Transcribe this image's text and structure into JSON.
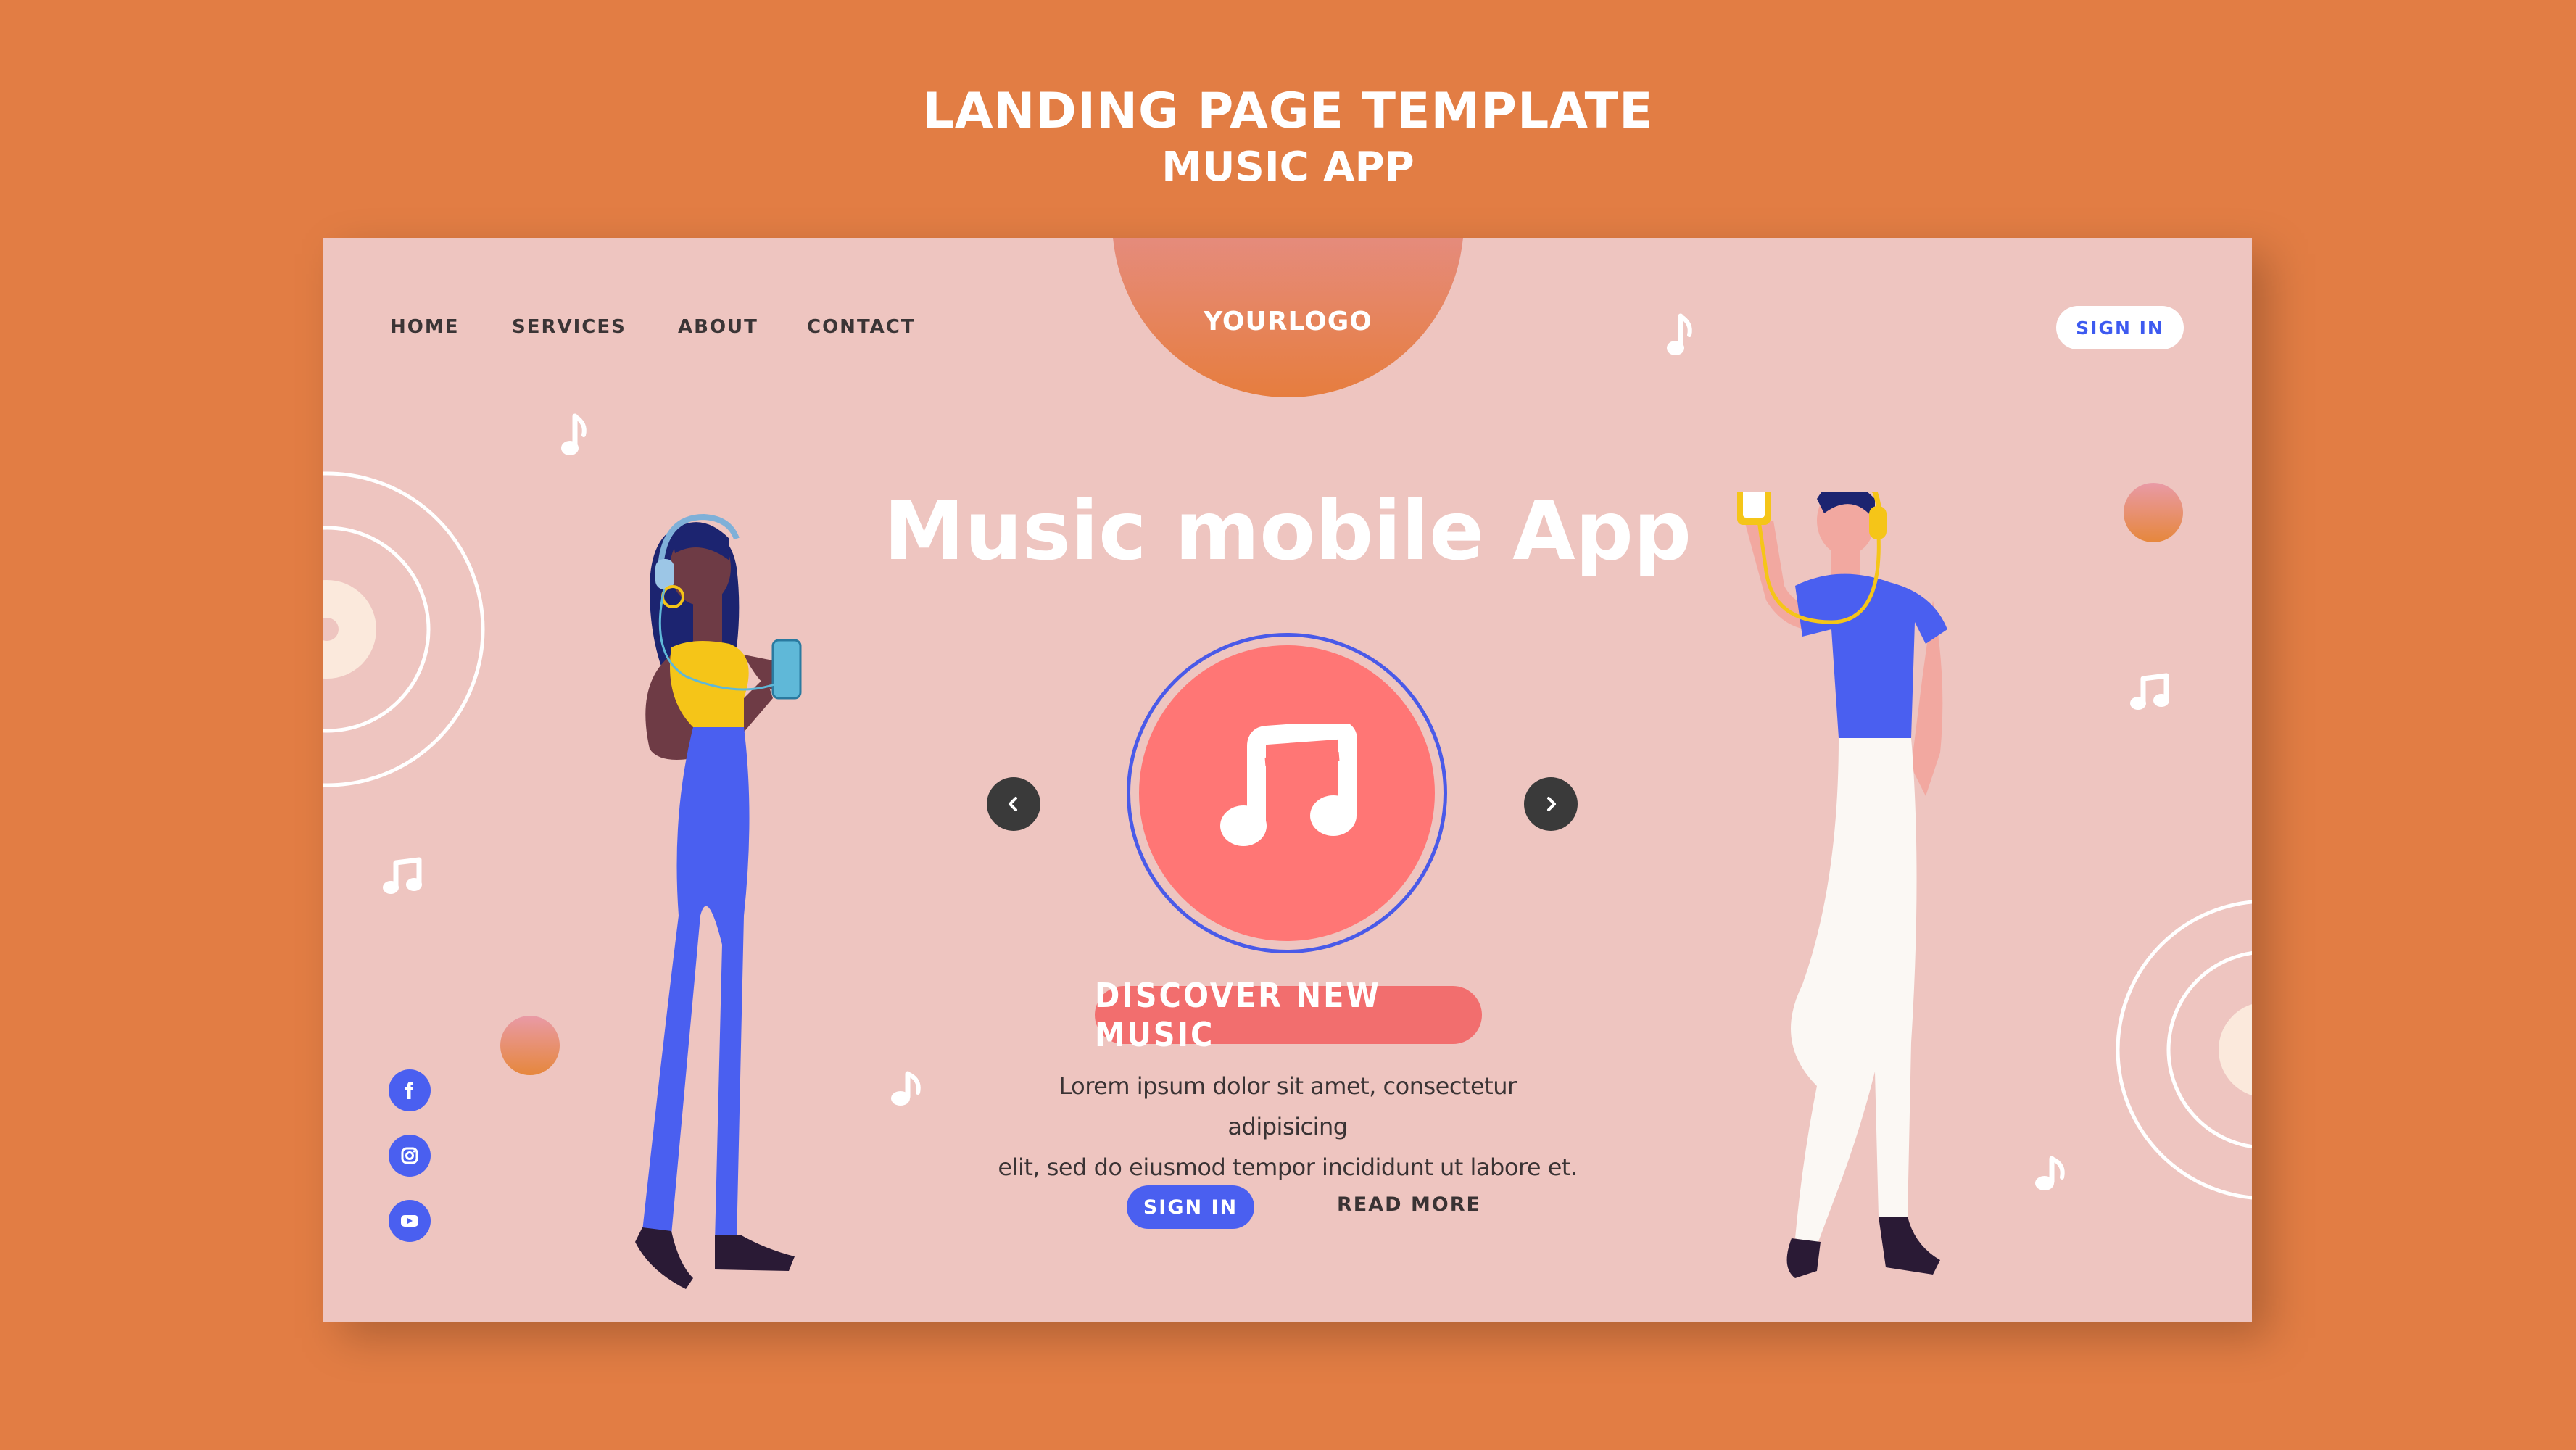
{
  "showcase": {
    "title": "LANDING PAGE TEMPLATE",
    "subtitle": "MUSIC APP"
  },
  "nav": {
    "items": [
      {
        "label": "HOME"
      },
      {
        "label": "SERVICES"
      },
      {
        "label": "ABOUT"
      },
      {
        "label": "CONTACT"
      }
    ],
    "logo": "YOURLOGO",
    "signin": "SIGN IN"
  },
  "hero": {
    "title": "Music mobile App",
    "badge": "DISCOVER NEW MUSIC",
    "text_line1": "Lorem ipsum dolor sit amet, consectetur adipisicing",
    "text_line2": "elit, sed do eiusmod tempor incididunt ut labore et.",
    "signin": "SIGN IN",
    "read_more": "READ MORE"
  },
  "social": [
    "facebook-icon",
    "instagram-icon",
    "youtube-icon"
  ],
  "colors": {
    "background": "#e27d44",
    "page": "#eec5c0",
    "accent_blue": "#4a5ff0",
    "accent_red": "#ff7675",
    "text_dark": "#3a3334"
  }
}
